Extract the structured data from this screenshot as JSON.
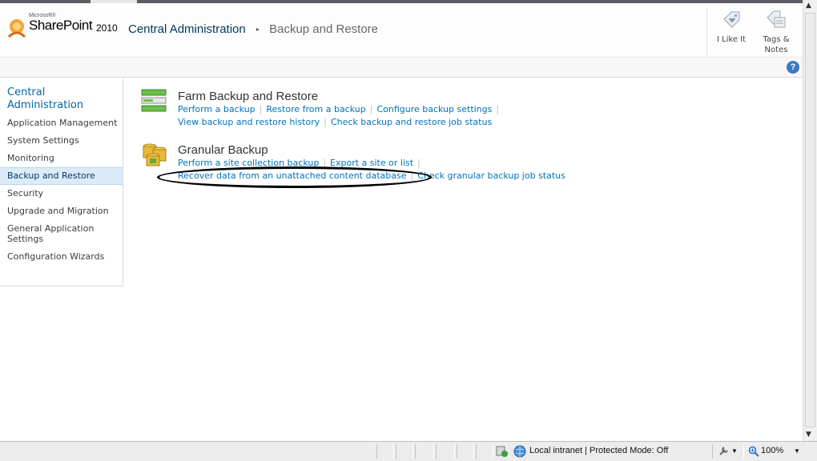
{
  "header": {
    "logo": {
      "microsoft": "Microsoft®",
      "product": "SharePoint",
      "version": "2010"
    },
    "breadcrumb": {
      "root": "Central Administration",
      "separator": "▸",
      "current": "Backup and Restore"
    },
    "social": [
      {
        "label_line1": "I Like It",
        "label_line2": "",
        "icon": "like-tag-icon"
      },
      {
        "label_line1": "Tags &",
        "label_line2": "Notes",
        "icon": "tags-notes-icon"
      }
    ],
    "help_glyph": "?"
  },
  "sidebar": {
    "heading": "Central Administration",
    "items": [
      {
        "label": "Application Management"
      },
      {
        "label": "System Settings"
      },
      {
        "label": "Monitoring"
      },
      {
        "label": "Backup and Restore",
        "selected": true
      },
      {
        "label": "Security"
      },
      {
        "label": "Upgrade and Migration"
      },
      {
        "label": "General Application Settings"
      },
      {
        "label": "Configuration Wizards"
      }
    ]
  },
  "main": {
    "sections": [
      {
        "title": "Farm Backup and Restore",
        "icon": "farm-backup-icon",
        "links_row1": [
          "Perform a backup",
          "Restore from a backup",
          "Configure backup settings"
        ],
        "links_row2": [
          "View backup and restore history",
          "Check backup and restore job status"
        ]
      },
      {
        "title": "Granular Backup",
        "icon": "granular-backup-icon",
        "links_row1": [
          "Perform a site collection backup",
          "Export a site or list"
        ],
        "links_row2": [
          "Recover data from an unattached content database",
          "Check granular backup job status"
        ]
      }
    ]
  },
  "statusbar": {
    "zone": "Local intranet | Protected Mode: Off",
    "zoom": "100%"
  },
  "colors": {
    "link": "#0072bc",
    "nav_heading": "#0066aa",
    "selected_bg": "#dcebfa",
    "help_icon": "#3a78c2"
  }
}
